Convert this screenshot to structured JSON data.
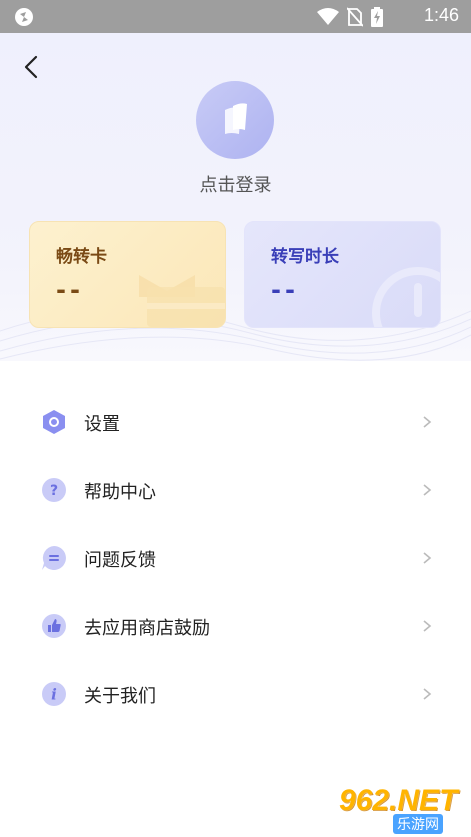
{
  "status_bar": {
    "time": "1:46"
  },
  "header": {
    "login_label": "点击登录"
  },
  "cards": [
    {
      "title": "畅转卡",
      "value": "--"
    },
    {
      "title": "转写时长",
      "value": "--"
    }
  ],
  "menu": {
    "items": [
      {
        "label": "设置",
        "icon": "settings-icon"
      },
      {
        "label": "帮助中心",
        "icon": "help-icon"
      },
      {
        "label": "问题反馈",
        "icon": "feedback-icon"
      },
      {
        "label": "去应用商店鼓励",
        "icon": "thumbs-up-icon"
      },
      {
        "label": "关于我们",
        "icon": "info-icon"
      }
    ]
  },
  "watermark": {
    "text": "962.NET",
    "sub": "乐游网"
  },
  "colors": {
    "accent": "#8a8ff0",
    "vip_text": "#7a4a15",
    "time_text": "#3a3fb8"
  }
}
